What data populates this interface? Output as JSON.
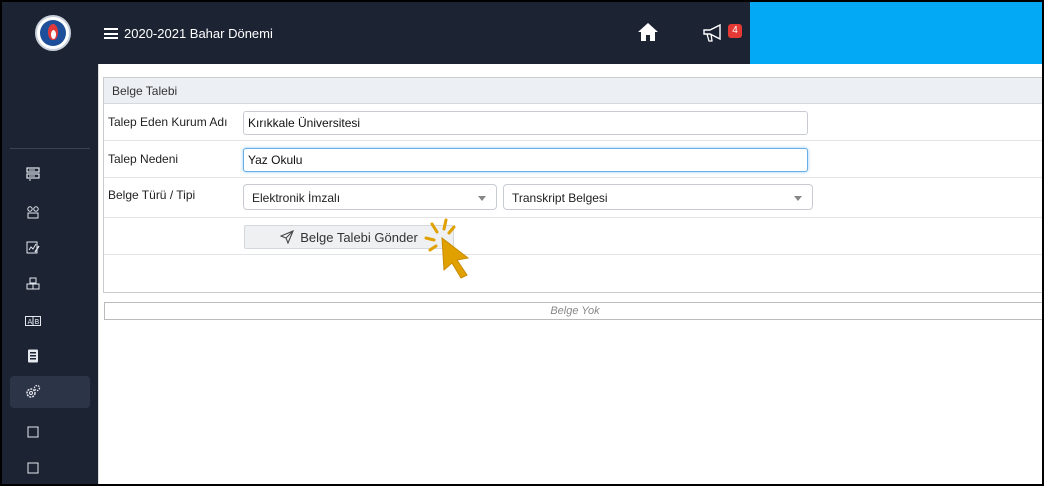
{
  "topbar": {
    "term": "2020-2021 Bahar Dönemi",
    "notification_count": "4"
  },
  "sidebar": {
    "icons": [
      "logo-icon",
      "server-icon",
      "users-tree-icon",
      "chart-edit-icon",
      "cubes-icon",
      "ab-icon",
      "document-icon",
      "gears-icon",
      "square-icon",
      "square-icon"
    ]
  },
  "form": {
    "title": "Belge Talebi",
    "institution_label": "Talep Eden Kurum Adı",
    "institution_value": "Kırıkkale Üniversitesi",
    "reason_label": "Talep Nedeni",
    "reason_value": "Yaz Okulu",
    "type_label": "Belge Türü / Tipi",
    "type_select": "Elektronik İmzalı",
    "doc_select": "Transkript Belgesi",
    "submit_label": "Belge Talebi Gönder"
  },
  "list": {
    "empty_text": "Belge Yok"
  },
  "colors": {
    "sidebar_bg": "#1c2333",
    "accent_box": "#03a9f4",
    "badge": "#e53935",
    "cursor": "#e0a100"
  }
}
